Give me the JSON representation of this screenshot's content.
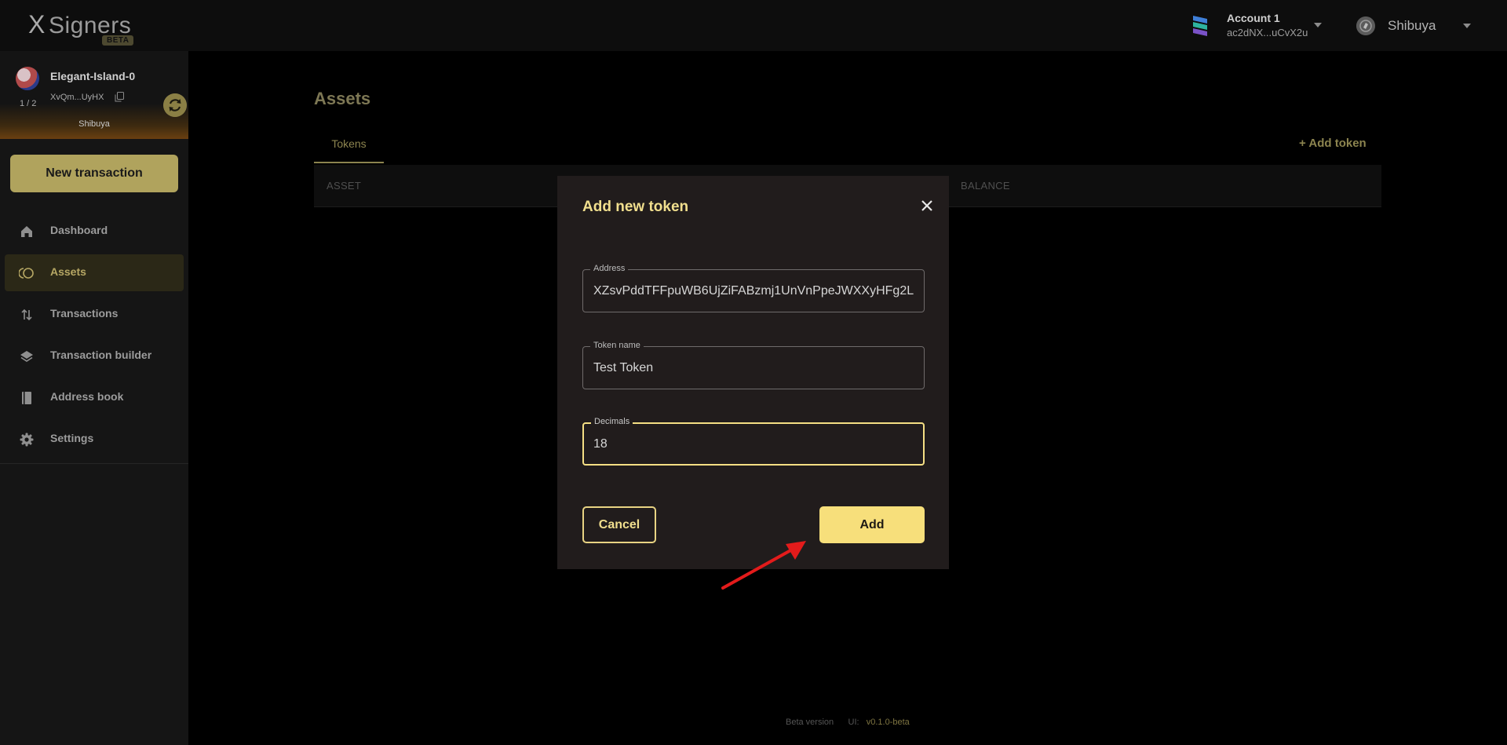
{
  "app": {
    "logo_text": "Signers",
    "logo_x": "X",
    "logo_badge": "BETA"
  },
  "header": {
    "account_name": "Account 1",
    "account_address": "ac2dNX...uCvX2u",
    "network_name": "Shibuya"
  },
  "sidebar": {
    "multisig_name": "Elegant-Island-0",
    "multisig_address": "XvQm...UyHX",
    "pager": "1 / 2",
    "multisig_network": "Shibuya",
    "new_transaction_label": "New transaction",
    "items": [
      {
        "label": "Dashboard",
        "icon": "home-icon",
        "active": false
      },
      {
        "label": "Assets",
        "icon": "assets-icon",
        "active": true
      },
      {
        "label": "Transactions",
        "icon": "transactions-icon",
        "active": false
      },
      {
        "label": "Transaction builder",
        "icon": "layers-icon",
        "active": false
      },
      {
        "label": "Address book",
        "icon": "book-icon",
        "active": false
      },
      {
        "label": "Settings",
        "icon": "gear-icon",
        "active": false
      }
    ]
  },
  "main": {
    "title": "Assets",
    "tabs": [
      {
        "label": "Tokens"
      }
    ],
    "add_token_label": "+ Add token",
    "table_headers": [
      "ASSET",
      "BALANCE"
    ]
  },
  "footer": {
    "beta_text": "Beta version",
    "ui_label": "UI:",
    "ui_version": "v0.1.0-beta"
  },
  "modal": {
    "title": "Add new token",
    "fields": {
      "address": {
        "label": "Address",
        "value": "XZsvPddTFFpuWB6UjZiFABzmj1UnVnPpeJWXXyHFg2L"
      },
      "token_name": {
        "label": "Token name",
        "value": "Test Token"
      },
      "decimals": {
        "label": "Decimals",
        "value": "18"
      }
    },
    "cancel_label": "Cancel",
    "add_label": "Add"
  },
  "colors": {
    "accent": "#f7df7b",
    "accent_muted": "#8c844f",
    "background": "#000000",
    "sidebar": "#151515",
    "modal": "#211c1c",
    "annotation_arrow": "#e31b1b"
  }
}
